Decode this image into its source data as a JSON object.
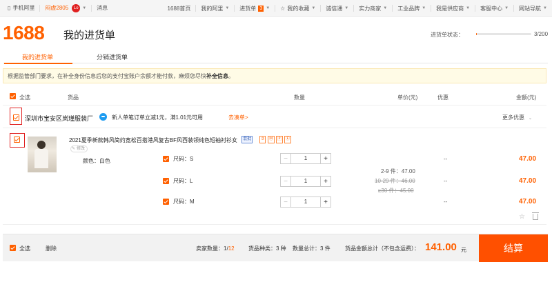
{
  "topbar": {
    "mobile_label": "手机阿里",
    "user_name": "闷虚2805",
    "user_badge": "Lo",
    "messages": "消息",
    "home": "1688首页",
    "my_ali": "我的阿里",
    "cart_label": "进货单",
    "cart_count": "3",
    "favorites": "我的收藏",
    "integrity": "诚信通",
    "merchant": "实力商家",
    "brand": "工业品牌",
    "supplier": "我是供应商",
    "service": "客服中心",
    "site_nav": "网站导航"
  },
  "header": {
    "logo": "1688",
    "title": "我的进货单",
    "progress_label": "进货单状态：",
    "progress_value": "3/200",
    "progress_fraction": 0.015
  },
  "tabs": {
    "active": "我的进货单",
    "other": "分销进货单"
  },
  "notice": {
    "text": "根据监管部门要求，在补全身份信息后您的支付宝账户余额才能付款，麻烦您尽快",
    "bold": "补全信息",
    "end": "。"
  },
  "table_header": {
    "select_all": "全选",
    "goods": "货品",
    "quantity": "数量",
    "unit_price": "单价(元)",
    "discount": "优惠",
    "amount": "金额(元)"
  },
  "store": {
    "name": "深圳市宝安区岚瑾服装厂",
    "promo": "新人单笔订单立减1元，满1.01元可用",
    "promo_link": "去凑单>",
    "more_promo": "更多优惠"
  },
  "product": {
    "title": "2021夏季新款韩风简约宽松百搭港风复古BF风西装领纯色短袖衬衫女",
    "tags": [
      "混批",
      "⑦",
      "Ⓜ",
      "🄿",
      "Ⓔ"
    ],
    "edit": "修改",
    "color": "颜色：白色",
    "sizes": [
      {
        "label": "尺码：S",
        "qty": "1",
        "amount": "47.00"
      },
      {
        "label": "尺码：L",
        "qty": "1",
        "amount": "47.00"
      },
      {
        "label": "尺码：M",
        "qty": "1",
        "amount": "47.00"
      }
    ],
    "tiers": [
      "2-9 件：47.00",
      "10-29 件：46.00",
      "≥30 件：45.00"
    ],
    "dashes": [
      "--",
      "--",
      "--"
    ]
  },
  "footer": {
    "select_all": "全选",
    "delete": "删除",
    "seller_count_label": "卖家数量：",
    "seller_count_a": "1",
    "seller_count_sep": "/",
    "seller_count_b": "12",
    "goods_kind_label": "货品种类：",
    "goods_kind_value": "3 种",
    "qty_total_label": "数量总计：",
    "qty_total_value": "3 件",
    "total_label": "货品金额总计（不包含运费）：",
    "total_amount": "141.00",
    "currency": "元",
    "settle": "结算"
  }
}
